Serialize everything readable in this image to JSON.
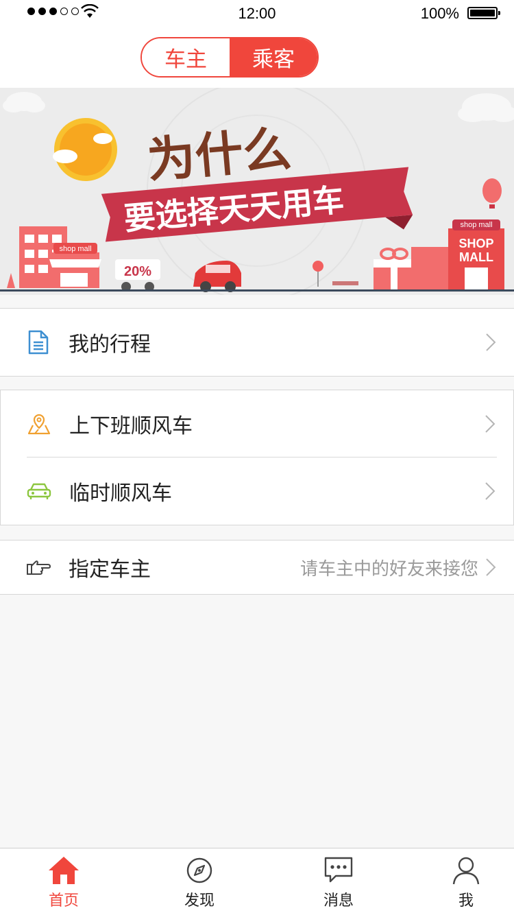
{
  "status_bar": {
    "time": "12:00",
    "battery": "100%"
  },
  "segmented": {
    "owner_label": "车主",
    "passenger_label": "乘客",
    "selected": "乘客"
  },
  "banner": {
    "line1": "为什么",
    "line2": "要选择天天用车",
    "shop_small": "shop mall",
    "shop_big_tag": "shop mall",
    "shop_big_line1": "SHOP",
    "shop_big_line2": "MALL",
    "discount": "20%"
  },
  "menu": {
    "my_trips": "我的行程",
    "commute": "上下班顺风车",
    "temporary": "临时顺风车",
    "designated_owner": "指定车主",
    "designated_hint": "请车主中的好友来接您"
  },
  "tabbar": {
    "home": "首页",
    "discover": "发现",
    "messages": "消息",
    "me": "我",
    "active": "home"
  },
  "colors": {
    "accent": "#f0463c",
    "doc_icon": "#3d8fd1",
    "map_icon": "#f0a030",
    "car_icon": "#8cc63f"
  }
}
